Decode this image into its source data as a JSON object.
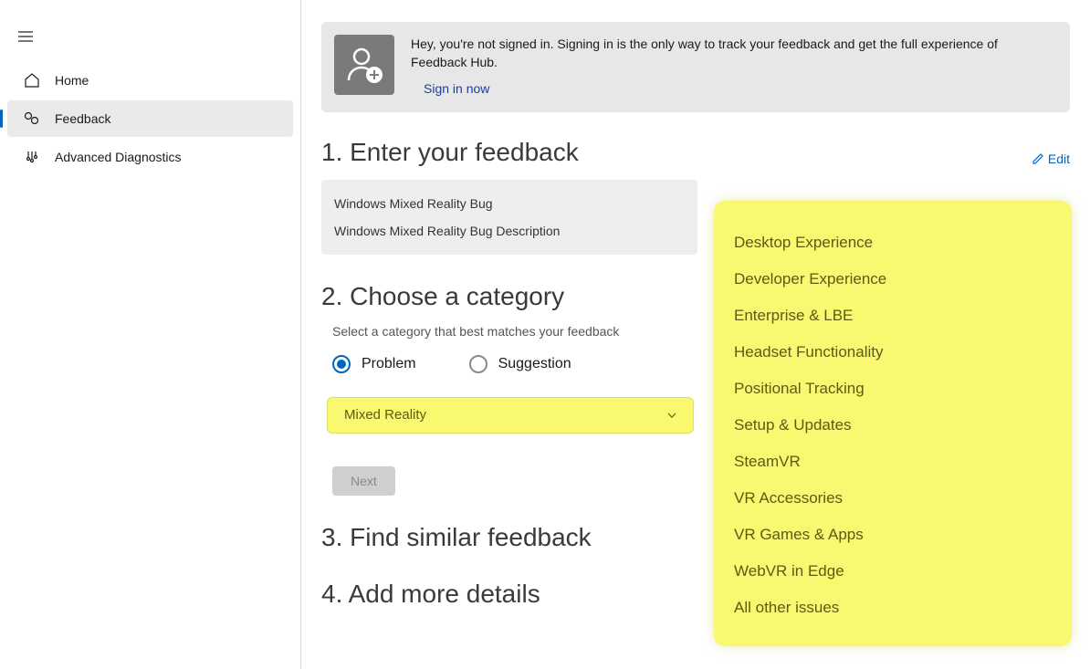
{
  "sidebar": {
    "items": [
      {
        "label": "Home",
        "icon": "home-icon",
        "active": false
      },
      {
        "label": "Feedback",
        "icon": "feedback-icon",
        "active": true
      },
      {
        "label": "Advanced Diagnostics",
        "icon": "diagnostics-icon",
        "active": false
      }
    ]
  },
  "banner": {
    "message": "Hey, you're not signed in. Signing in is the only way to track your feedback and get the full experience of Feedback Hub.",
    "signin_label": "Sign in now"
  },
  "edit_label": "Edit",
  "step1": {
    "title": "1. Enter your feedback",
    "summary_title": "Windows Mixed Reality Bug",
    "summary_desc": "Windows Mixed Reality Bug Description"
  },
  "step2": {
    "title": "2. Choose a category",
    "subtext": "Select a category that best matches your feedback",
    "radio_problem": "Problem",
    "radio_suggestion": "Suggestion",
    "dropdown_value": "Mixed Reality",
    "next_label": "Next"
  },
  "step3": {
    "title": "3. Find similar feedback"
  },
  "step4": {
    "title": "4. Add more details"
  },
  "options": [
    "Desktop Experience",
    "Developer Experience",
    "Enterprise & LBE",
    "Headset Functionality",
    "Positional Tracking",
    "Setup & Updates",
    "SteamVR",
    "VR Accessories",
    "VR Games & Apps",
    "WebVR in Edge",
    "All other issues"
  ]
}
